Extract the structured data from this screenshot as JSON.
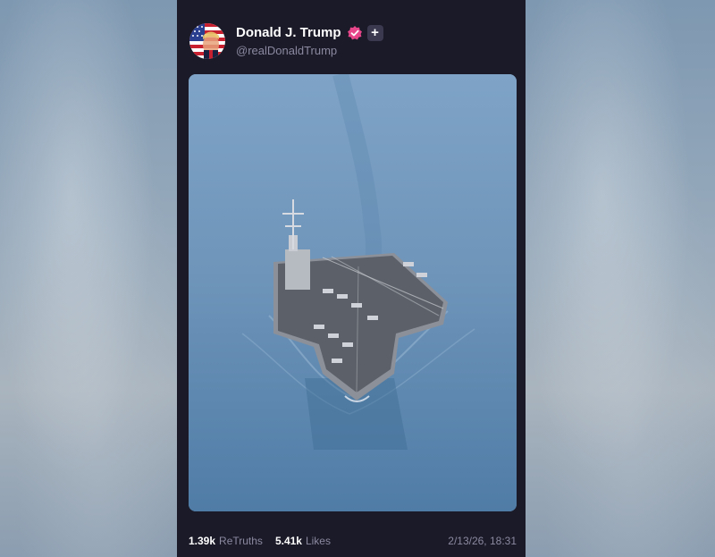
{
  "post": {
    "author": {
      "display_name": "Donald J. Trump",
      "handle": "@realDonaldTrump",
      "avatar_icon": "flag-avatar-icon",
      "verified_icon": "verified-badge-icon",
      "plus_icon": "plus-icon",
      "verified_color": "#e8468a"
    },
    "media": {
      "icon": "aircraft-carrier-photo"
    },
    "stats": {
      "retruths_count": "1.39k",
      "retruths_label": "ReTruths",
      "likes_count": "5.41k",
      "likes_label": "Likes"
    },
    "timestamp": "2/13/26, 18:31"
  },
  "colors": {
    "card_bg": "#1b1a28",
    "text_primary": "#ffffff",
    "text_secondary": "#8a89a0"
  }
}
